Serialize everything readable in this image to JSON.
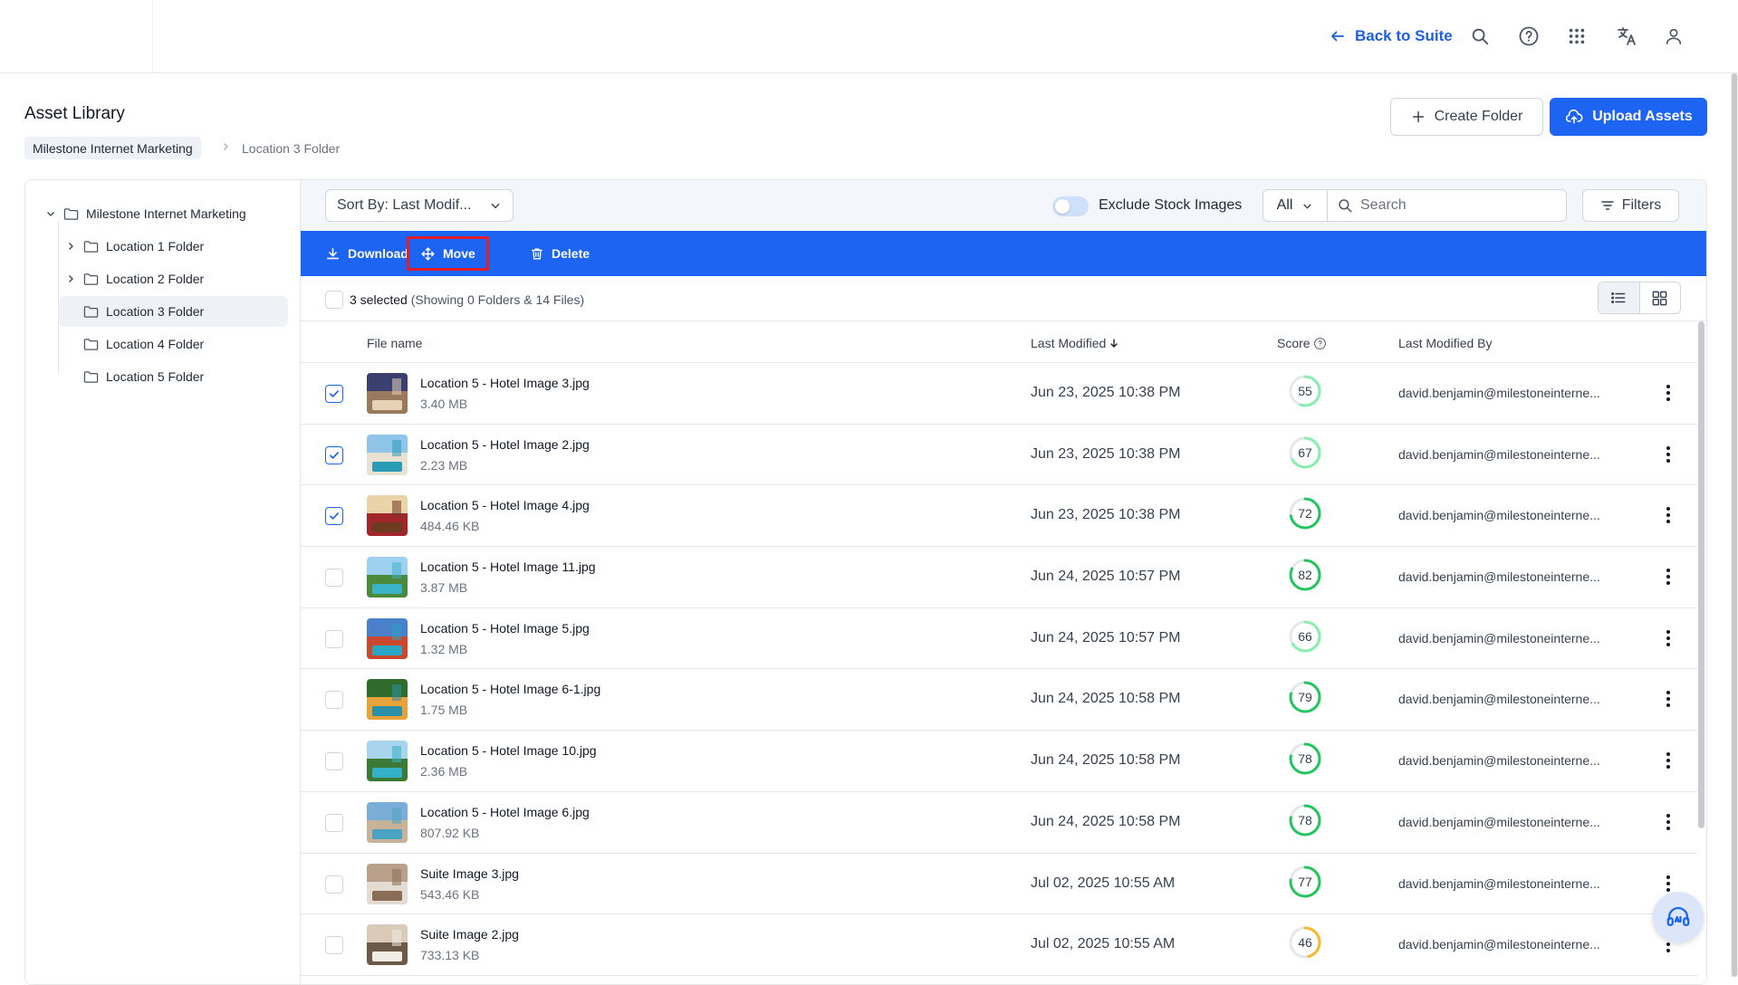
{
  "header": {
    "back_label": "Back to Suite",
    "icons": [
      "search-icon",
      "help-icon",
      "apps-grid-icon",
      "translate-icon",
      "user-icon"
    ]
  },
  "page": {
    "title": "Asset Library",
    "breadcrumb_root": "Milestone Internet Marketing",
    "breadcrumb_current": "Location 3 Folder",
    "create_folder_label": "Create Folder",
    "upload_label": "Upload Assets"
  },
  "tree": {
    "root": "Milestone Internet Marketing",
    "items": [
      {
        "label": "Location 1 Folder",
        "expandable": true
      },
      {
        "label": "Location 2 Folder",
        "expandable": true
      },
      {
        "label": "Location 3 Folder",
        "expandable": false,
        "active": true
      },
      {
        "label": "Location 4 Folder",
        "expandable": false
      },
      {
        "label": "Location 5 Folder",
        "expandable": false
      }
    ]
  },
  "toolbar": {
    "sort_label": "Sort By: Last Modif...",
    "exclude_stock_label": "Exclude Stock Images",
    "exclude_stock_on": false,
    "type_filter": "All",
    "search_placeholder": "Search",
    "filters_label": "Filters"
  },
  "actions": {
    "download": "Download",
    "move": "Move",
    "delete": "Delete"
  },
  "selection": {
    "count_text": "3 selected",
    "summary_text": "(Showing 0 Folders & 14 Files)"
  },
  "table": {
    "columns": {
      "file_name": "File name",
      "last_modified": "Last Modified",
      "score": "Score",
      "last_modified_by": "Last Modified By"
    },
    "rows": [
      {
        "name": "Location 5 - Hotel Image 3.jpg",
        "size": "3.40 MB",
        "date": "Jun 23, 2025 10:38 PM",
        "score": 55,
        "by": "david.benjamin@milestoneinterne...",
        "checked": true,
        "thumb": [
          "#3b3f6e",
          "#9a7a5c",
          "#e7d2b8"
        ]
      },
      {
        "name": "Location 5 - Hotel Image 2.jpg",
        "size": "2.23 MB",
        "date": "Jun 23, 2025 10:38 PM",
        "score": 67,
        "by": "david.benjamin@milestoneinterne...",
        "checked": true,
        "thumb": [
          "#8ec5e8",
          "#e8e2d2",
          "#2a9bb5"
        ]
      },
      {
        "name": "Location 5 - Hotel Image 4.jpg",
        "size": "484.46 KB",
        "date": "Jun 23, 2025 10:38 PM",
        "score": 72,
        "by": "david.benjamin@milestoneinterne...",
        "checked": true,
        "thumb": [
          "#e9d3a8",
          "#a0262c",
          "#6b3b22"
        ]
      },
      {
        "name": "Location 5 - Hotel Image 11.jpg",
        "size": "3.87 MB",
        "date": "Jun 24, 2025 10:57 PM",
        "score": 82,
        "by": "david.benjamin@milestoneinterne...",
        "checked": false,
        "thumb": [
          "#9ed0ef",
          "#4b8a3a",
          "#3db3c9"
        ]
      },
      {
        "name": "Location 5 - Hotel Image 5.jpg",
        "size": "1.32 MB",
        "date": "Jun 24, 2025 10:57 PM",
        "score": 66,
        "by": "david.benjamin@milestoneinterne...",
        "checked": false,
        "thumb": [
          "#4a7fc9",
          "#c9482e",
          "#2aa6c4"
        ]
      },
      {
        "name": "Location 5 - Hotel Image 6-1.jpg",
        "size": "1.75 MB",
        "date": "Jun 24, 2025 10:58 PM",
        "score": 79,
        "by": "david.benjamin@milestoneinterne...",
        "checked": false,
        "thumb": [
          "#2f6b2a",
          "#e7a23a",
          "#2b8fa8"
        ]
      },
      {
        "name": "Location 5 - Hotel Image 10.jpg",
        "size": "2.36 MB",
        "date": "Jun 24, 2025 10:58 PM",
        "score": 78,
        "by": "david.benjamin@milestoneinterne...",
        "checked": false,
        "thumb": [
          "#a8d4ee",
          "#3a7a35",
          "#34b0c7"
        ]
      },
      {
        "name": "Location 5 - Hotel Image 6.jpg",
        "size": "807.92 KB",
        "date": "Jun 24, 2025 10:58 PM",
        "score": 78,
        "by": "david.benjamin@milestoneinterne...",
        "checked": false,
        "thumb": [
          "#7aaed9",
          "#c6b39a",
          "#4aa3c0"
        ]
      },
      {
        "name": "Suite Image 3.jpg",
        "size": "543.46 KB",
        "date": "Jul 02, 2025 10:55 AM",
        "score": 77,
        "by": "david.benjamin@milestoneinterne...",
        "checked": false,
        "thumb": [
          "#b9a08a",
          "#e4dcd2",
          "#8a6d57"
        ]
      },
      {
        "name": "Suite Image 2.jpg",
        "size": "733.13 KB",
        "date": "Jul 02, 2025 10:55 AM",
        "score": 46,
        "by": "david.benjamin@milestoneinterne...",
        "checked": false,
        "thumb": [
          "#d9cbb8",
          "#6d5a46",
          "#f1ece4"
        ]
      }
    ]
  },
  "colors": {
    "primary": "#1d64f2",
    "highlight_border": "#e11d2a",
    "score_green": "#22c55e",
    "score_light_green": "#86efac",
    "score_yellow": "#f5b82e"
  }
}
